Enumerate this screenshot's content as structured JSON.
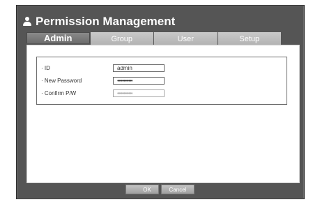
{
  "window": {
    "title": "Permission Management",
    "icon": "user-icon"
  },
  "tabs": [
    {
      "label": "Admin",
      "active": true
    },
    {
      "label": "Group",
      "active": false
    },
    {
      "label": "User",
      "active": false
    },
    {
      "label": "Setup",
      "active": false
    }
  ],
  "form": {
    "id": {
      "label": "· ID",
      "value": "admin"
    },
    "new_password": {
      "label": "· New Password",
      "value": "••••••••••••"
    },
    "confirm_password": {
      "label": "· Confirm P/W",
      "value": "••••••••••••"
    }
  },
  "buttons": {
    "ok": "OK",
    "cancel": "Cancel"
  }
}
